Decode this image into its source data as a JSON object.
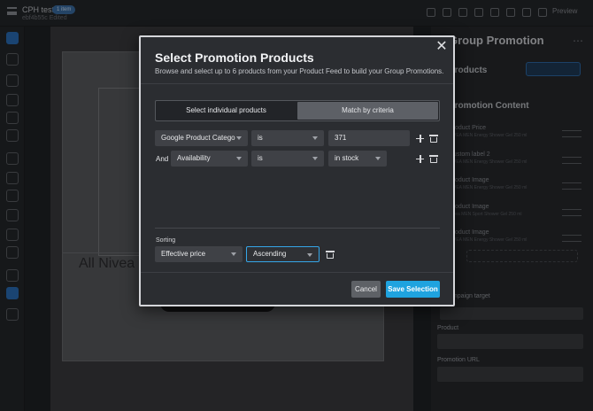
{
  "app": {
    "title": "CPH test",
    "subtitle": "ebf4b55c Edited",
    "badge": "1 item",
    "preview_label": "Preview"
  },
  "background": {
    "canvas_text": "All Nivea m",
    "panel_title": "Group Promotion",
    "products_label": "Products",
    "add_selection": "Add Selection",
    "promotion_content": "Promotion Content",
    "items": [
      {
        "label": "Product Price",
        "sub": "NIVEA MEN Energy Shower Gel 250 ml"
      },
      {
        "label": "Custom label 2",
        "sub": "NIVEA MEN Energy Shower Gel 250 ml"
      },
      {
        "label": "Product Image",
        "sub": "NIVEA MEN Energy Shower Gel 250 ml"
      },
      {
        "label": "Product Image",
        "sub": "Nivea MEN Sport Shower Gel 250 ml"
      },
      {
        "label": "Product Image",
        "sub": "NIVEA MEN Energy Shower Gel 250 ml"
      }
    ],
    "add_product_item": "Add product item",
    "campaign_target": "Campaign target",
    "tab_promotion_link": "Promotion link",
    "tab_url": "URL",
    "product_label": "Product",
    "product_value": "F000001 - Nivea MEN Sport Shower Gel 2...",
    "promotion_url_label": "Promotion URL",
    "promotion_url_value": "Custom label 4"
  },
  "modal": {
    "title": "Select Promotion Products",
    "subtitle": "Browse and select up to 6 products from your Product Feed to build your Group Promotions.",
    "tabs": [
      {
        "label": "Select individual products",
        "active": false
      },
      {
        "label": "Match by criteria",
        "active": true
      }
    ],
    "criteria": [
      {
        "prefix": "",
        "field": "Google Product Catego",
        "operator": "is",
        "value": "371",
        "value_type": "input"
      },
      {
        "prefix": "And",
        "field": "Availability",
        "operator": "is",
        "value": "in stock",
        "value_type": "select"
      }
    ],
    "sorting_label": "Sorting",
    "sort_field": "Effective price",
    "sort_order": "Ascending",
    "cancel_label": "Cancel",
    "save_label": "Save Selection",
    "close_symbol": "✕"
  },
  "colors": {
    "accent": "#1fa3df",
    "focus": "#35a6e8"
  },
  "icons": [
    "menu-icon",
    "close-icon",
    "plus-icon",
    "trash-icon",
    "chevron-down-icon"
  ]
}
